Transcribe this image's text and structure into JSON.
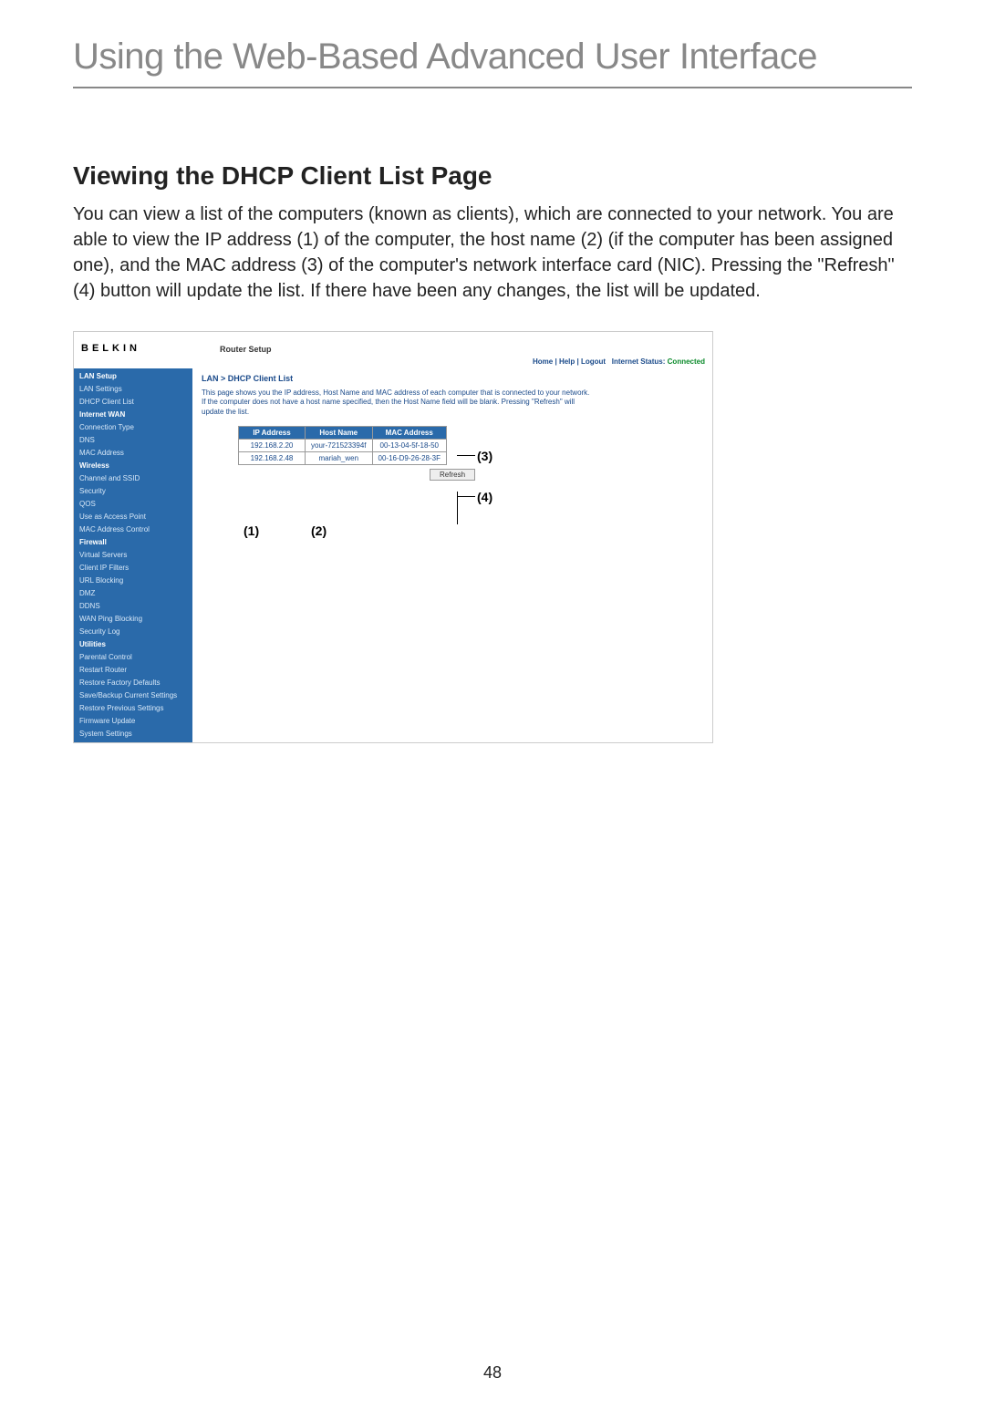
{
  "page": {
    "main_title": "Using the Web-Based Advanced User Interface",
    "section_title": "Viewing the DHCP Client List Page",
    "body_text": "You can view a list of the computers (known as clients), which are connected to your network. You are able to view the IP address (1) of the computer, the host name (2) (if the computer has been assigned one), and the MAC address (3) of the computer's network interface card (NIC). Pressing the \"Refresh\" (4) button will update the list. If there have been any changes, the list will be updated.",
    "page_number": "48"
  },
  "screenshot": {
    "brand": "BELKIN",
    "router_setup": "Router Setup",
    "top_links": {
      "home": "Home",
      "help": "Help",
      "logout": "Logout",
      "status_label": "Internet Status:",
      "status_value": "Connected"
    },
    "nav": [
      {
        "text": "LAN Setup",
        "head": true
      },
      {
        "text": "LAN Settings"
      },
      {
        "text": "DHCP Client List"
      },
      {
        "text": "Internet WAN",
        "head": true
      },
      {
        "text": "Connection Type"
      },
      {
        "text": "DNS"
      },
      {
        "text": "MAC Address"
      },
      {
        "text": "Wireless",
        "head": true
      },
      {
        "text": "Channel and SSID"
      },
      {
        "text": "Security"
      },
      {
        "text": "QOS"
      },
      {
        "text": "Use as Access Point"
      },
      {
        "text": "MAC Address Control"
      },
      {
        "text": "Firewall",
        "head": true
      },
      {
        "text": "Virtual Servers"
      },
      {
        "text": "Client IP Filters"
      },
      {
        "text": "URL Blocking"
      },
      {
        "text": "DMZ"
      },
      {
        "text": "DDNS"
      },
      {
        "text": "WAN Ping Blocking"
      },
      {
        "text": "Security Log"
      },
      {
        "text": "Utilities",
        "head": true
      },
      {
        "text": "Parental Control"
      },
      {
        "text": "Restart Router"
      },
      {
        "text": "Restore Factory Defaults"
      },
      {
        "text": "Save/Backup Current Settings"
      },
      {
        "text": "Restore Previous Settings"
      },
      {
        "text": "Firmware Update"
      },
      {
        "text": "System Settings"
      }
    ],
    "breadcrumb": "LAN > DHCP Client List",
    "desc": "This page shows you the IP address, Host Name and MAC address of each computer that is connected to your network. If the computer does not have a host name specified, then the Host Name field will be blank. Pressing \"Refresh\" will update the list.",
    "table": {
      "headers": [
        "IP Address",
        "Host Name",
        "MAC Address"
      ],
      "rows": [
        [
          "192.168.2.20",
          "your-721523394f",
          "00-13-04-5f-18-50"
        ],
        [
          "192.168.2.48",
          "mariah_wen",
          "00-16-D9-26-28-3F"
        ]
      ]
    },
    "refresh": "Refresh"
  },
  "callouts": {
    "c1": "(1)",
    "c2": "(2)",
    "c3": "(3)",
    "c4": "(4)"
  }
}
